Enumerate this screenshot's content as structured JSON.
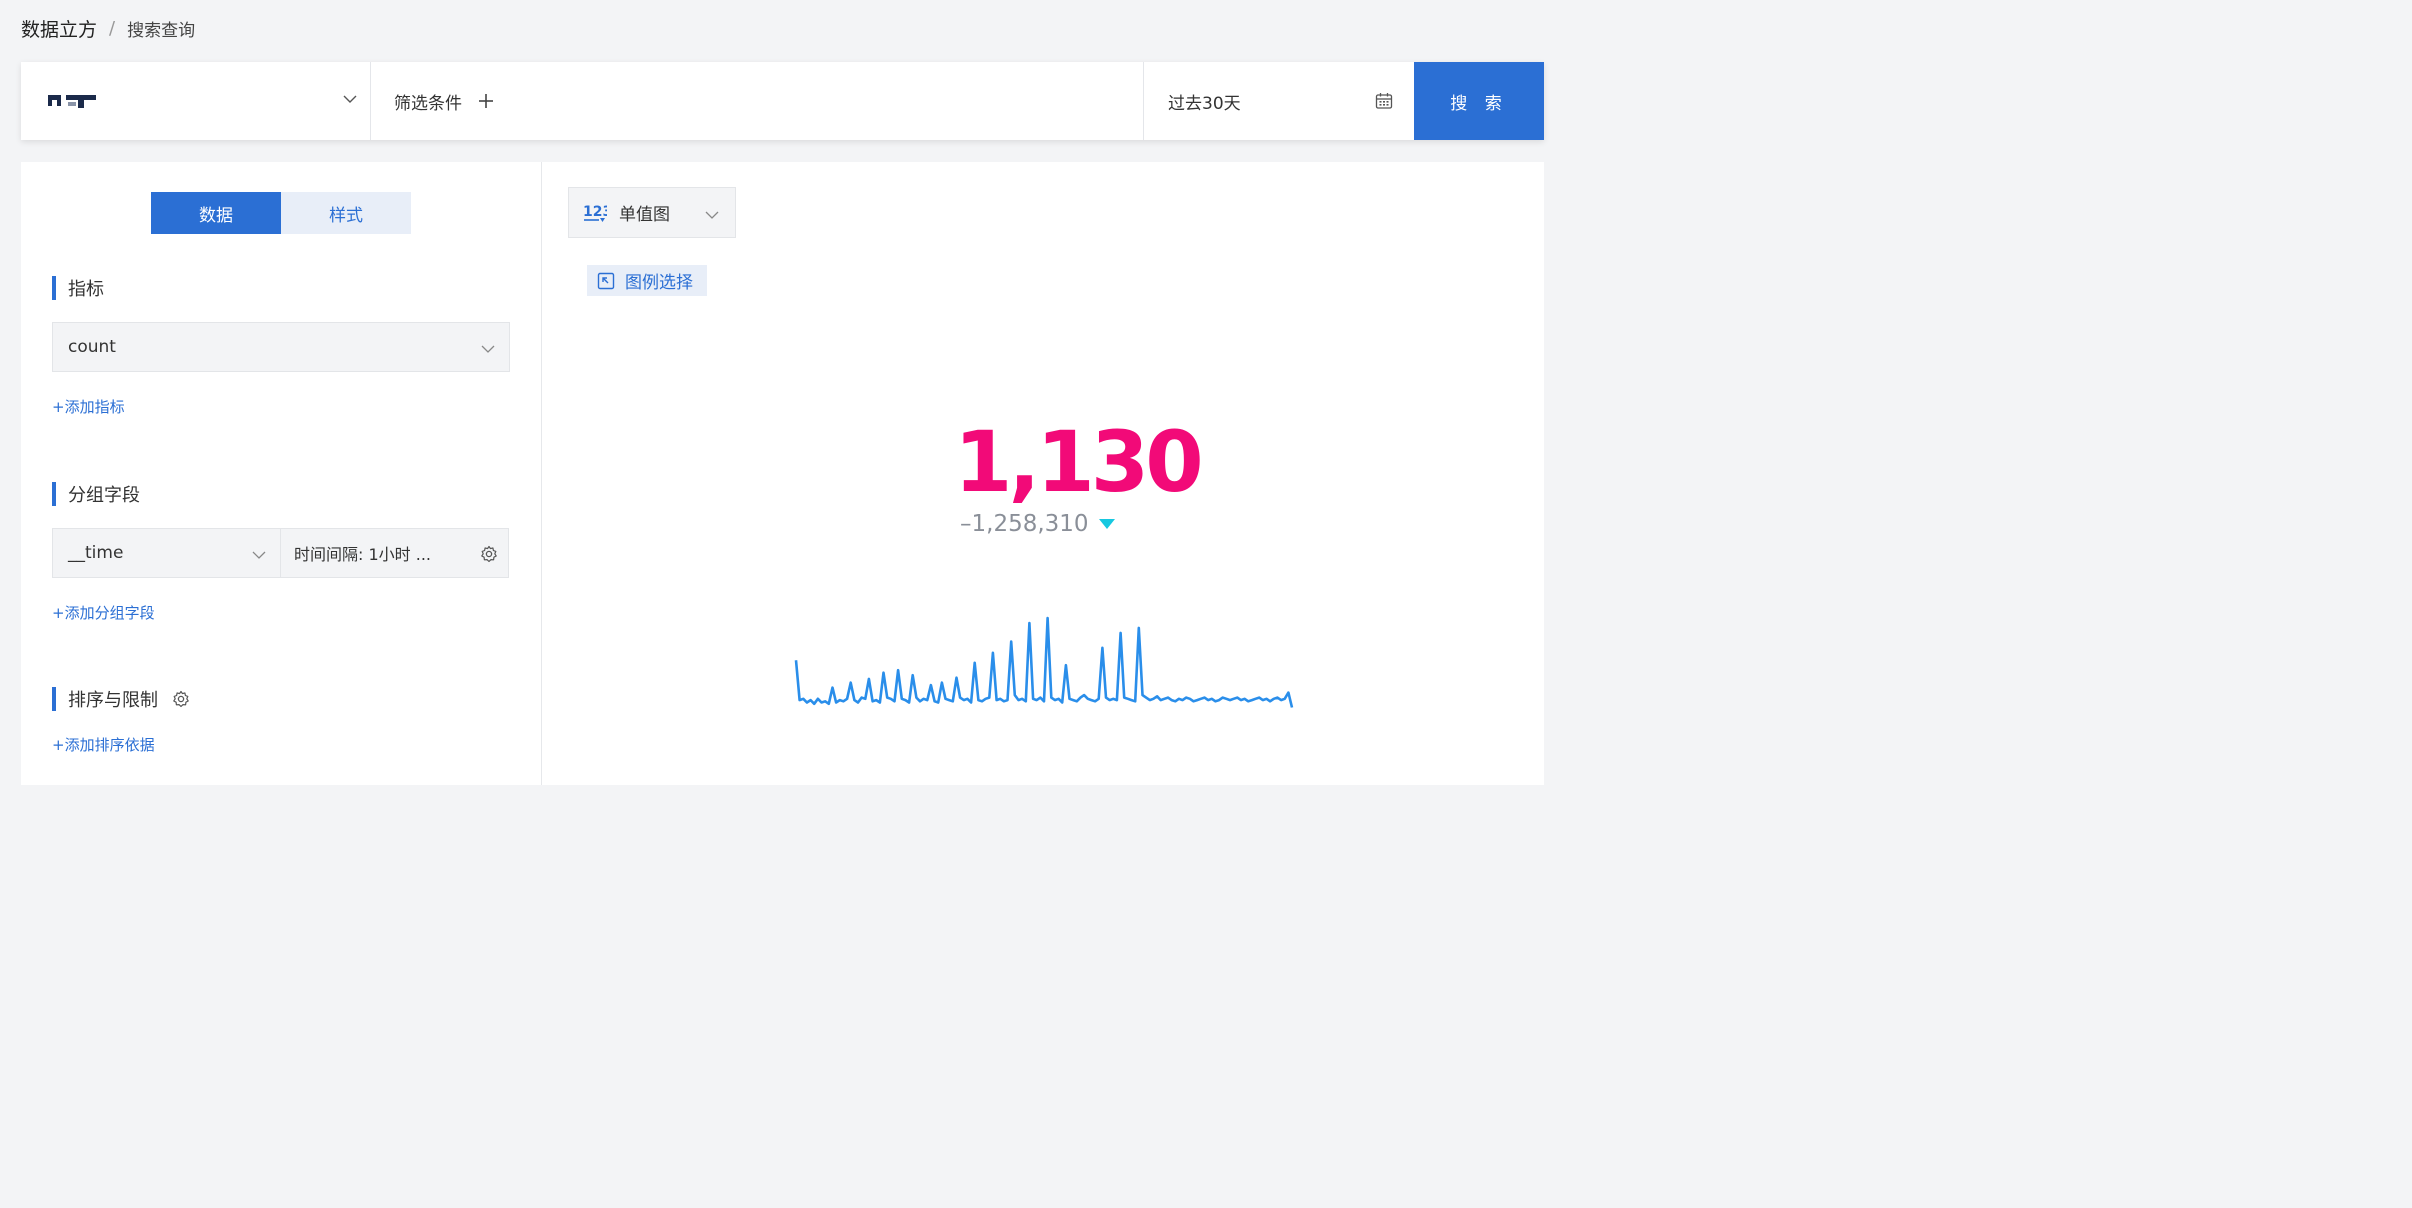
{
  "breadcrumb": {
    "root": "数据立方",
    "separator": "/",
    "current": "搜索查询"
  },
  "querybar": {
    "source_icon": "datasource-logo-icon",
    "filter_label": "筛选条件",
    "add_filter_icon": "plus-icon",
    "time_range": "过去30天",
    "calendar_icon": "calendar-icon",
    "search_label": "搜 索"
  },
  "config_panel": {
    "tabs": [
      {
        "label": "数据",
        "active": true
      },
      {
        "label": "样式",
        "active": false
      }
    ],
    "metrics": {
      "title": "指标",
      "selected": "count",
      "add_link": "+添加指标"
    },
    "group_by": {
      "title": "分组字段",
      "field": "__time",
      "interval": "时间间隔: 1小时 ...",
      "settings_icon": "gear-icon",
      "add_link": "+添加分组字段"
    },
    "sort": {
      "title": "排序与限制",
      "settings_icon": "gear-icon",
      "add_link": "+添加排序依据"
    }
  },
  "visual_panel": {
    "chart_type_icon": "number-123-icon",
    "chart_type": "单值图",
    "legend_button": "图例选择",
    "legend_icon": "legend-select-icon"
  },
  "colors": {
    "accent": "#2b6fd4",
    "value": "#f20a78",
    "delta": "#8a8f98",
    "down_arrow": "#17c8e0",
    "sparkline": "#2a8eea"
  },
  "chart_data": {
    "type": "line",
    "single_value": "1,130",
    "delta": "–1,258,310",
    "delta_direction": "down",
    "series": [
      {
        "values": [
          40,
          8,
          9,
          6,
          8,
          5,
          9,
          6,
          7,
          5,
          18,
          6,
          8,
          7,
          9,
          22,
          8,
          6,
          10,
          9,
          25,
          7,
          8,
          6,
          30,
          10,
          9,
          7,
          32,
          9,
          8,
          6,
          28,
          10,
          7,
          9,
          8,
          20,
          7,
          6,
          22,
          9,
          8,
          7,
          26,
          10,
          8,
          9,
          6,
          38,
          8,
          7,
          9,
          10,
          46,
          8,
          9,
          7,
          8,
          55,
          12,
          8,
          9,
          7,
          70,
          9,
          8,
          10,
          7,
          74,
          10,
          8,
          9,
          6,
          36,
          9,
          8,
          7,
          10,
          12,
          9,
          8,
          7,
          9,
          50,
          10,
          8,
          9,
          8,
          62,
          10,
          9,
          8,
          7,
          66,
          12,
          10,
          8,
          9,
          11,
          8,
          9,
          10,
          8,
          7,
          9,
          8,
          10,
          9,
          7,
          8,
          9,
          10,
          8,
          9,
          7,
          8,
          10,
          9,
          8,
          9,
          10,
          8,
          9,
          7,
          8,
          9,
          10,
          8,
          9,
          7,
          9,
          10,
          8,
          9,
          14,
          2
        ]
      }
    ]
  }
}
